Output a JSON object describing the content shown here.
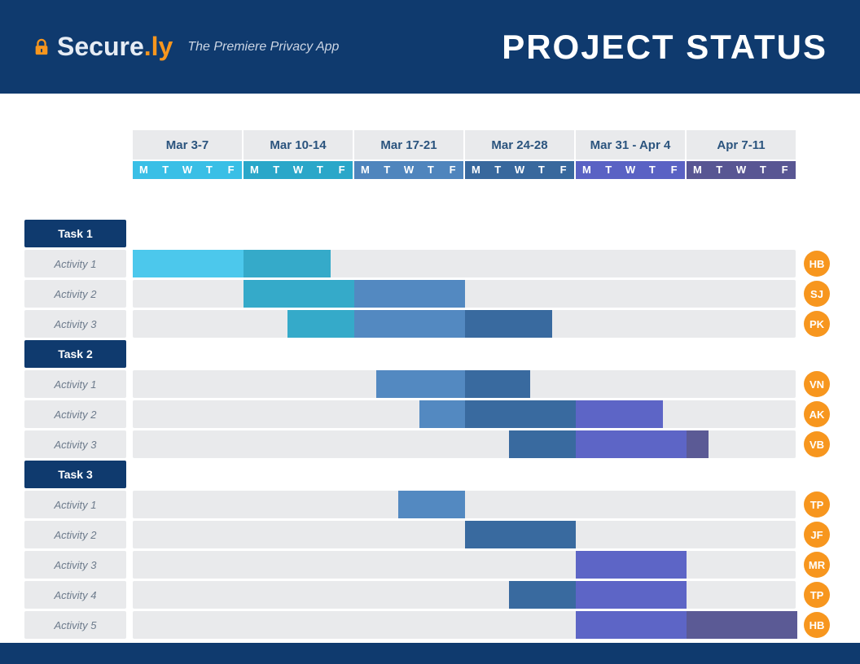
{
  "brand": {
    "name1": "Secure",
    "dot": ".",
    "name2": "ly",
    "tagline": "The Premiere Privacy App"
  },
  "title": "PROJECT STATUS",
  "day_labels": [
    "M",
    "T",
    "W",
    "T",
    "F"
  ],
  "weeks": [
    {
      "label": "Mar 3-7",
      "cls": "w-blue1"
    },
    {
      "label": "Mar 10-14",
      "cls": "w-blue2"
    },
    {
      "label": "Mar 17-21",
      "cls": "w-blue3"
    },
    {
      "label": "Mar 24-28",
      "cls": "w-blue4"
    },
    {
      "label": "Mar 31 - Apr 4",
      "cls": "w-blue5"
    },
    {
      "label": "Apr 7-11",
      "cls": "w-blue6"
    }
  ],
  "tasks": [
    {
      "name": "Task 1",
      "activities": [
        {
          "name": "Activity 1",
          "owner": "HB",
          "bars": [
            {
              "s": 0,
              "e": 5,
              "c": "c-light"
            },
            {
              "s": 5,
              "e": 9,
              "c": "c-teal"
            }
          ]
        },
        {
          "name": "Activity 2",
          "owner": "SJ",
          "bars": [
            {
              "s": 5,
              "e": 10,
              "c": "c-teal"
            },
            {
              "s": 10,
              "e": 15,
              "c": "c-blue"
            }
          ]
        },
        {
          "name": "Activity 3",
          "owner": "PK",
          "bars": [
            {
              "s": 7,
              "e": 10,
              "c": "c-teal"
            },
            {
              "s": 10,
              "e": 15,
              "c": "c-blue"
            },
            {
              "s": 15,
              "e": 19,
              "c": "c-navy"
            }
          ]
        }
      ]
    },
    {
      "name": "Task 2",
      "activities": [
        {
          "name": "Activity 1",
          "owner": "VN",
          "bars": [
            {
              "s": 11,
              "e": 15,
              "c": "c-blue"
            },
            {
              "s": 15,
              "e": 18,
              "c": "c-navy"
            }
          ]
        },
        {
          "name": "Activity 2",
          "owner": "AK",
          "bars": [
            {
              "s": 13,
              "e": 15,
              "c": "c-blue"
            },
            {
              "s": 15,
              "e": 20,
              "c": "c-navy"
            },
            {
              "s": 20,
              "e": 24,
              "c": "c-indigo"
            }
          ]
        },
        {
          "name": "Activity 3",
          "owner": "VB",
          "bars": [
            {
              "s": 17,
              "e": 20,
              "c": "c-navy"
            },
            {
              "s": 20,
              "e": 25,
              "c": "c-indigo"
            },
            {
              "s": 25,
              "e": 26,
              "c": "c-violet"
            }
          ]
        }
      ]
    },
    {
      "name": "Task 3",
      "activities": [
        {
          "name": "Activity 1",
          "owner": "TP",
          "bars": [
            {
              "s": 12,
              "e": 15,
              "c": "c-blue"
            }
          ]
        },
        {
          "name": "Activity 2",
          "owner": "JF",
          "bars": [
            {
              "s": 15,
              "e": 20,
              "c": "c-navy"
            }
          ]
        },
        {
          "name": "Activity 3",
          "owner": "MR",
          "bars": [
            {
              "s": 20,
              "e": 25,
              "c": "c-indigo"
            }
          ]
        },
        {
          "name": "Activity 4",
          "owner": "TP",
          "bars": [
            {
              "s": 17,
              "e": 20,
              "c": "c-navy"
            },
            {
              "s": 20,
              "e": 25,
              "c": "c-indigo"
            }
          ]
        },
        {
          "name": "Activity 5",
          "owner": "HB",
          "bars": [
            {
              "s": 20,
              "e": 25,
              "c": "c-indigo"
            },
            {
              "s": 25,
              "e": 30,
              "c": "c-violet"
            }
          ]
        }
      ]
    }
  ],
  "chart_data": {
    "type": "gantt",
    "title": "PROJECT STATUS",
    "x_unit": "day_index (0-29, Mon-Fri over 6 weeks starting Mar 3)",
    "weeks": [
      "Mar 3-7",
      "Mar 10-14",
      "Mar 17-21",
      "Mar 24-28",
      "Mar 31 - Apr 4",
      "Apr 7-11"
    ],
    "day_labels": [
      "M",
      "T",
      "W",
      "T",
      "F"
    ],
    "xlim": [
      0,
      30
    ],
    "series": [
      {
        "group": "Task 1",
        "name": "Activity 1",
        "owner": "HB",
        "segments": [
          {
            "start": 0,
            "end": 5,
            "stage": "stage1"
          },
          {
            "start": 5,
            "end": 9,
            "stage": "stage2"
          }
        ]
      },
      {
        "group": "Task 1",
        "name": "Activity 2",
        "owner": "SJ",
        "segments": [
          {
            "start": 5,
            "end": 10,
            "stage": "stage2"
          },
          {
            "start": 10,
            "end": 15,
            "stage": "stage3"
          }
        ]
      },
      {
        "group": "Task 1",
        "name": "Activity 3",
        "owner": "PK",
        "segments": [
          {
            "start": 7,
            "end": 10,
            "stage": "stage2"
          },
          {
            "start": 10,
            "end": 15,
            "stage": "stage3"
          },
          {
            "start": 15,
            "end": 19,
            "stage": "stage4"
          }
        ]
      },
      {
        "group": "Task 2",
        "name": "Activity 1",
        "owner": "VN",
        "segments": [
          {
            "start": 11,
            "end": 15,
            "stage": "stage3"
          },
          {
            "start": 15,
            "end": 18,
            "stage": "stage4"
          }
        ]
      },
      {
        "group": "Task 2",
        "name": "Activity 2",
        "owner": "AK",
        "segments": [
          {
            "start": 13,
            "end": 15,
            "stage": "stage3"
          },
          {
            "start": 15,
            "end": 20,
            "stage": "stage4"
          },
          {
            "start": 20,
            "end": 24,
            "stage": "stage5"
          }
        ]
      },
      {
        "group": "Task 2",
        "name": "Activity 3",
        "owner": "VB",
        "segments": [
          {
            "start": 17,
            "end": 20,
            "stage": "stage4"
          },
          {
            "start": 20,
            "end": 25,
            "stage": "stage5"
          },
          {
            "start": 25,
            "end": 26,
            "stage": "stage6"
          }
        ]
      },
      {
        "group": "Task 3",
        "name": "Activity 1",
        "owner": "TP",
        "segments": [
          {
            "start": 12,
            "end": 15,
            "stage": "stage3"
          }
        ]
      },
      {
        "group": "Task 3",
        "name": "Activity 2",
        "owner": "JF",
        "segments": [
          {
            "start": 15,
            "end": 20,
            "stage": "stage4"
          }
        ]
      },
      {
        "group": "Task 3",
        "name": "Activity 3",
        "owner": "MR",
        "segments": [
          {
            "start": 20,
            "end": 25,
            "stage": "stage5"
          }
        ]
      },
      {
        "group": "Task 3",
        "name": "Activity 4",
        "owner": "TP",
        "segments": [
          {
            "start": 17,
            "end": 20,
            "stage": "stage4"
          },
          {
            "start": 20,
            "end": 25,
            "stage": "stage5"
          }
        ]
      },
      {
        "group": "Task 3",
        "name": "Activity 5",
        "owner": "HB",
        "segments": [
          {
            "start": 20,
            "end": 25,
            "stage": "stage5"
          },
          {
            "start": 25,
            "end": 30,
            "stage": "stage6"
          }
        ]
      }
    ],
    "stage_colors": {
      "stage1": "#4cc8ec",
      "stage2": "#35aac9",
      "stage3": "#5389c1",
      "stage4": "#396a9f",
      "stage5": "#5d65c6",
      "stage6": "#5b5a95"
    }
  }
}
